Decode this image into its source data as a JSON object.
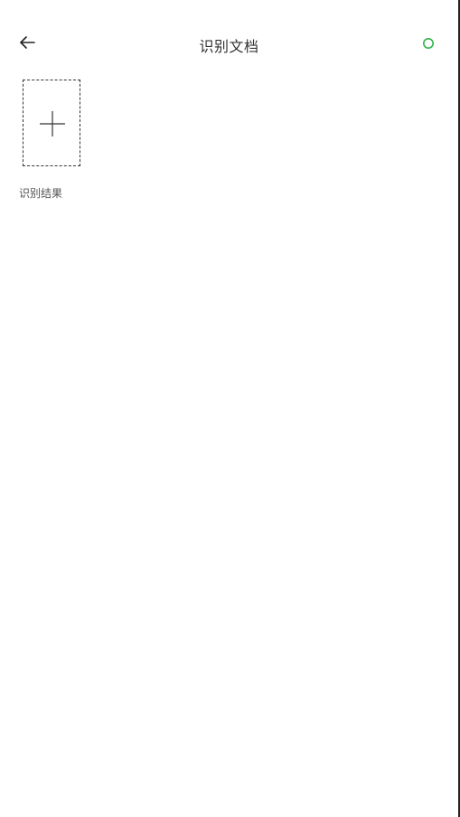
{
  "header": {
    "title": "识别文档",
    "back_icon": "arrow-left-icon",
    "sync_icon": "circle-refresh-icon",
    "sync_color": "#2fb54a"
  },
  "main": {
    "add_card": {
      "icon": "plus-icon"
    },
    "card_label": "识别结果"
  }
}
